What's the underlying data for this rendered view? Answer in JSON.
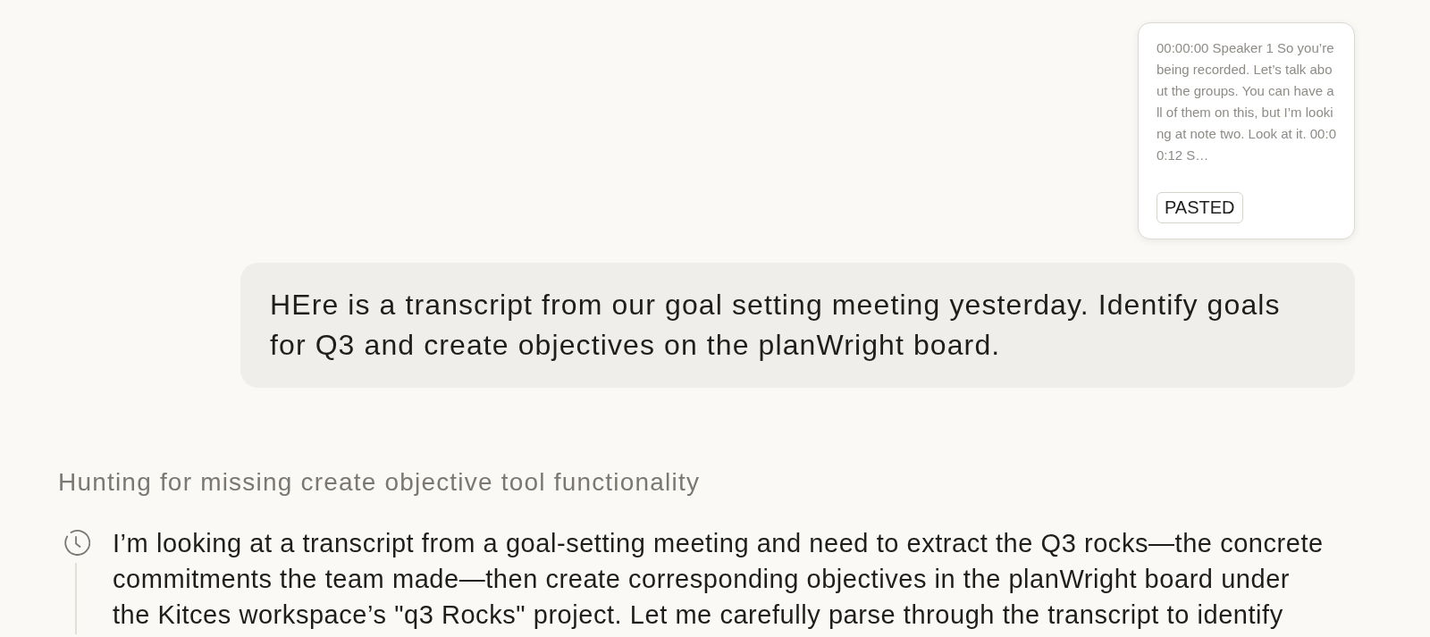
{
  "pasted_card": {
    "preview": "00:00:00 Speaker 1 So you’re being recorded. Let’s talk about the groups. You can have all of them on this, but I’m looking at note two. Look at it. 00:00:12 S…",
    "badge": "PASTED"
  },
  "user_message": {
    "text": "HEre is a transcript from our goal setting meeting yesterday. Identify goals for Q3 and create objectives on the planWright board."
  },
  "thinking": {
    "title": "Hunting for missing create objective tool functionality",
    "text": "I’m looking at a transcript from a goal-setting meeting and need to extract the Q3 rocks—the concrete commitments the team made—then create corresponding objectives in the planWright board under the Kitces workspace’s \"q3 Rocks\" project. Let me carefully parse through the transcript to identify"
  }
}
